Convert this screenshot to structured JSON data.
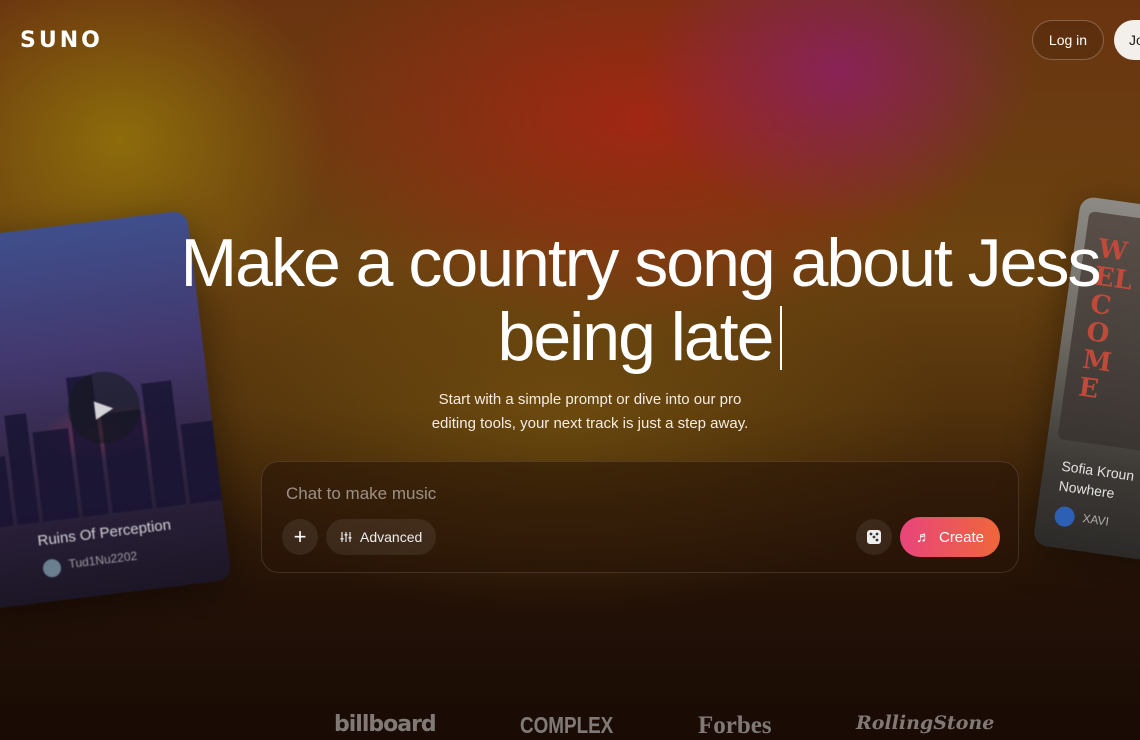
{
  "header": {
    "logo": "SUNO",
    "login_label": "Log in",
    "join_label": "Jo"
  },
  "hero": {
    "headline": "Make a country song about Jess being late",
    "subtitle": "Start with a simple prompt or dive into our pro editing tools, your next track is just a step away."
  },
  "prompt": {
    "placeholder": "Chat to make music",
    "value": "",
    "plus_label": "+",
    "advanced_label": "Advanced",
    "create_label": "Create"
  },
  "cards": {
    "left": {
      "title": "Ruins Of Perception",
      "user": "Tud1Nu2202"
    },
    "right": {
      "poster_text": "WELCOME",
      "title": "Sofia Kroun",
      "subtitle": "Nowhere",
      "user": "XAVI"
    }
  },
  "press": [
    "billboard",
    "COMPLEX",
    "Forbes",
    "RollingStone"
  ],
  "colors": {
    "create_gradient_start": "#e8457c",
    "create_gradient_end": "#f0663a",
    "join_bg": "#f3efea"
  },
  "icons": {
    "plus": "plus-icon",
    "advanced": "sliders-icon",
    "dice": "dice-icon",
    "create": "music-note-icon",
    "play": "play-icon"
  }
}
